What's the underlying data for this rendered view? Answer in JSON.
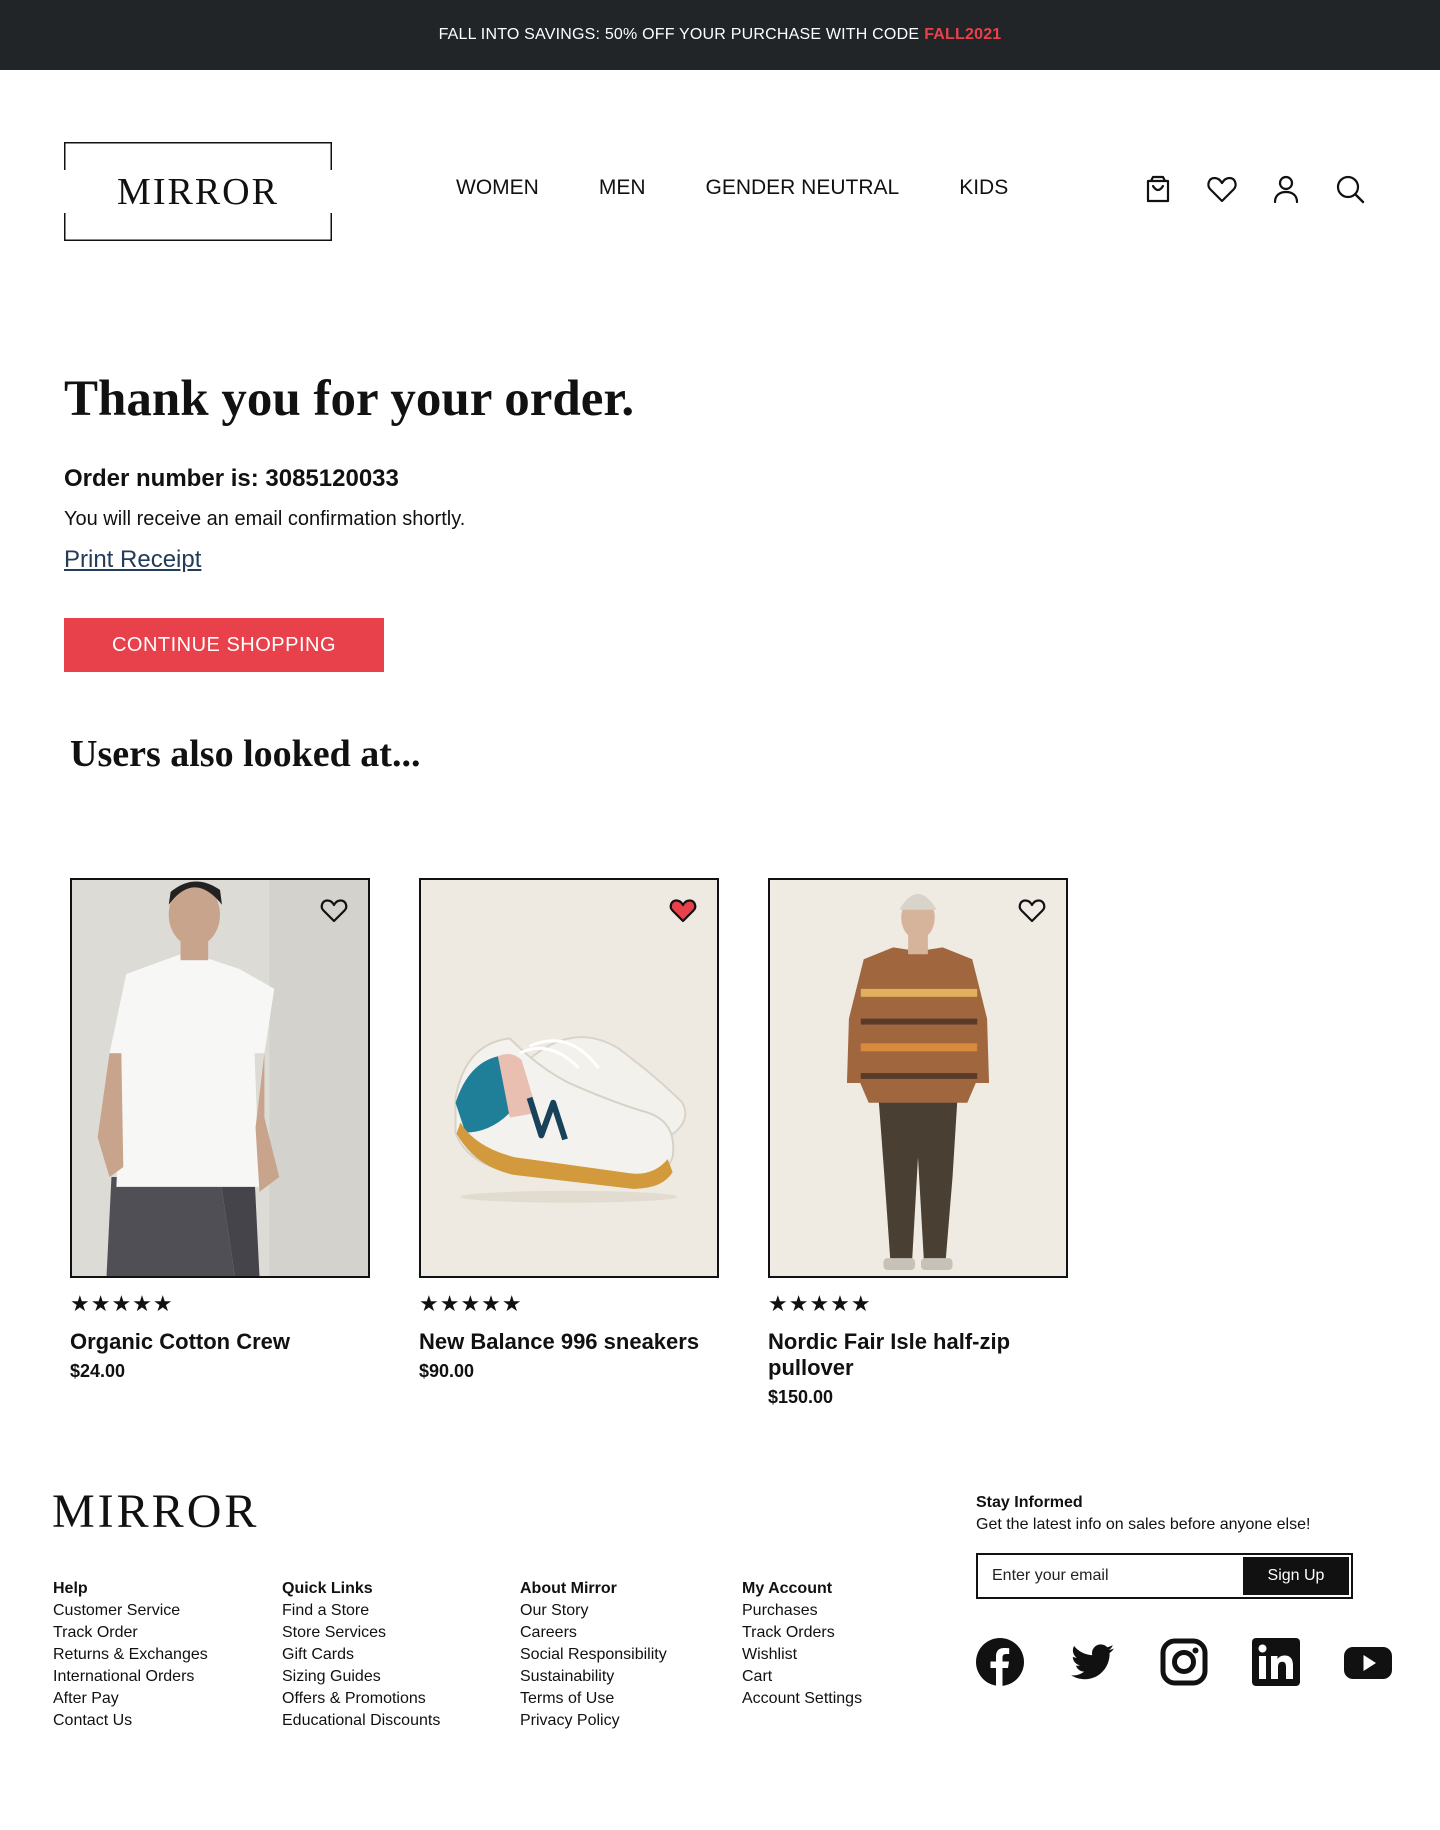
{
  "promo": {
    "text": "FALL INTO SAVINGS: 50% OFF YOUR PURCHASE WITH CODE",
    "code": "FALL2021"
  },
  "header": {
    "logo": "MIRROR",
    "nav": [
      "WOMEN",
      "MEN",
      "GENDER NEUTRAL",
      "KIDS"
    ],
    "icons": [
      "shopping-bag-icon",
      "heart-icon",
      "user-icon",
      "search-icon"
    ]
  },
  "confirmation": {
    "title": "Thank you for your order.",
    "order_label": "Order number is:",
    "order_number": "3085120033",
    "email_text": "You will receive an email confirmation shortly.",
    "print_label": "Print Receipt",
    "continue_label": "CONTINUE SHOPPING"
  },
  "recommendations": {
    "title": "Users also looked at...",
    "products": [
      {
        "name": "Organic Cotton Crew",
        "price": "$24.00",
        "stars": "★★★★★",
        "favorited": false
      },
      {
        "name": "New Balance 996 sneakers",
        "price": "$90.00",
        "stars": "★★★★★",
        "favorited": true
      },
      {
        "name": "Nordic Fair Isle half-zip pullover",
        "price": "$150.00",
        "stars": "★★★★★",
        "favorited": false
      }
    ]
  },
  "footer": {
    "logo": "MIRROR",
    "columns": [
      {
        "title": "Help",
        "links": [
          "Customer Service",
          "Track Order",
          "Returns & Exchanges",
          "International Orders",
          "After Pay",
          "Contact Us"
        ]
      },
      {
        "title": "Quick Links",
        "links": [
          "Find a Store",
          "Store Services",
          "Gift Cards",
          "Sizing Guides",
          "Offers & Promotions",
          "Educational Discounts"
        ]
      },
      {
        "title": "About Mirror",
        "links": [
          "Our Story",
          "Careers",
          "Social Responsibility",
          "Sustainability",
          "Terms of Use",
          "Privacy Policy"
        ]
      },
      {
        "title": "My Account",
        "links": [
          "Purchases",
          "Track Orders",
          "Wishlist",
          "Cart",
          "Account Settings"
        ]
      }
    ],
    "newsletter": {
      "title": "Stay Informed",
      "subtitle": "Get the latest info on sales before anyone else!",
      "placeholder": "Enter your email",
      "button": "Sign Up"
    },
    "socials": [
      "facebook-icon",
      "twitter-icon",
      "instagram-icon",
      "linkedin-icon",
      "youtube-icon"
    ]
  },
  "colors": {
    "accent": "#e8414b",
    "promo_bg": "#222528",
    "link": "#243b5a"
  }
}
